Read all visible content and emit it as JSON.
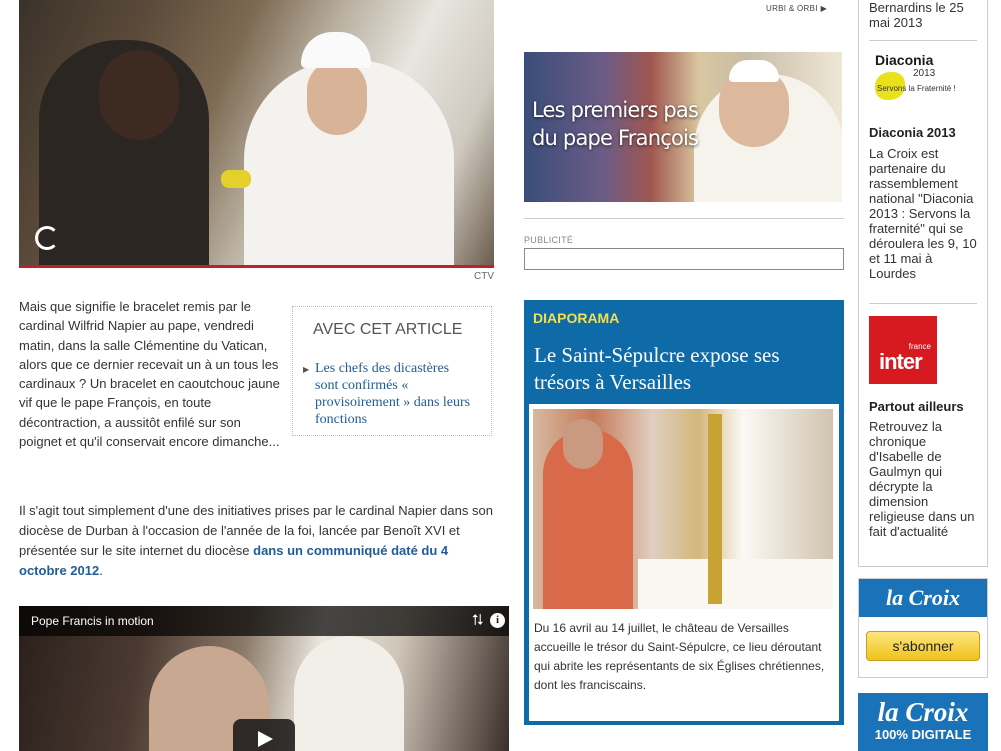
{
  "main": {
    "photo_credit": "CTV",
    "para1": "Mais que signifie le bracelet remis par le cardinal Wilfrid Napier au pape, vendredi matin, dans la salle Clémentine du Vatican, alors que ce dernier recevait un à un tous les cardinaux ? Un bracelet en caoutchouc jaune vif que le pape François, en toute décontraction, a aussitôt enfilé sur son poignet et qu'il conservait encore dimanche...",
    "related": {
      "title": "AVEC CET ARTICLE",
      "link": "Les chefs des dicastères sont confirmés « provisoirement » dans leurs fonctions"
    },
    "para2_start": "Il s'agit tout simplement d'une des initiatives prises par le cardinal Napier dans son diocèse de Durban à l'occasion de l'année de la foi, lancée par Benoît XVI et présentée sur le site internet du diocèse ",
    "para2_link": "dans un communiqué daté du 4 octobre 2012",
    "para2_end": ".",
    "video_title": "Pope Francis in motion"
  },
  "middle": {
    "urbi_link": "URBI & ORBI",
    "banner_text": "Les premiers pas du pape François",
    "pub_label": "PUBLICITÉ",
    "diaporama": {
      "label": "DIAPORAMA",
      "title": "Le Saint-Sépulcre expose ses trésors à Versailles",
      "caption": "Du 16 avril au 14 juillet, le château de Versailles accueille le trésor du Saint-Sépulcre, ce lieu déroutant qui abrite les représentants de six Églises chrétiennes, dont les franciscains."
    }
  },
  "right": {
    "top_text": "Bernardins le 25 mai 2013",
    "diaconia_logo": {
      "wordmark": "Diaconia",
      "year": "2013",
      "slogan": "Servons la Fraternité !"
    },
    "diaconia_title": "Diaconia 2013",
    "diaconia_text": "La Croix est partenaire du rassemblement national \"Diaconia 2013 : Servons la fraternité\" qui se déroulera les 9, 10 et 11 mai  à Lourdes",
    "inter_logo": {
      "france": "france",
      "inter": "inter"
    },
    "partout_title": "Partout ailleurs",
    "partout_text": "Retrouvez la chronique d'Isabelle de Gaulmyn qui décrypte la dimension religieuse dans un fait d'actualité",
    "abonner_logo": "la Croix",
    "abonner_button": "s'abonner",
    "digitale_logo": "la Croix",
    "digitale_sub": "100% DIGITALE"
  }
}
